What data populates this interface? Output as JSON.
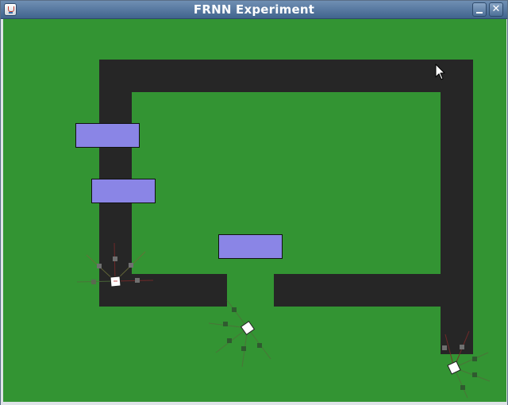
{
  "window": {
    "title": "FRNN Experiment",
    "icon": "java-cup-icon"
  },
  "controls": {
    "minimize_icon": "minimize-icon",
    "close_icon": "close-icon",
    "close_glyph": "✕"
  },
  "colors": {
    "field": "#339433",
    "wall": "#262626",
    "food": "#8a85e6",
    "agent": "#ffffff",
    "sensor": "#5a7a50"
  },
  "arena": {
    "food_count": 3,
    "agent_count": 3
  }
}
